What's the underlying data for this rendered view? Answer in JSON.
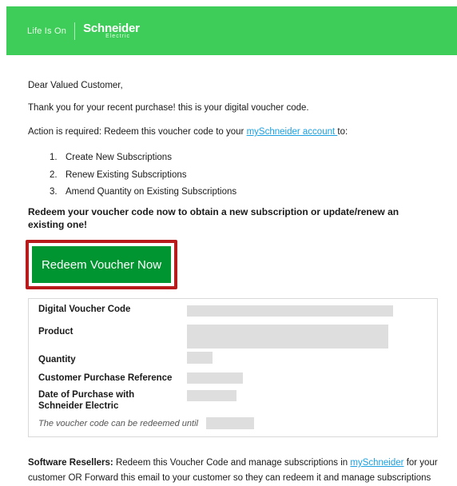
{
  "header": {
    "tagline": "Life Is On",
    "logo_main": "Schneider",
    "logo_sub": "Electric"
  },
  "greeting": "Dear Valued Customer,",
  "intro": "Thank you for your recent purchase! this is your digital voucher code.",
  "action": {
    "prefix": "Action is required: Redeem this voucher code to your ",
    "link": "mySchneider account ",
    "suffix": "to:"
  },
  "steps": [
    {
      "num": "1.",
      "text": "Create New Subscriptions"
    },
    {
      "num": "2.",
      "text": "Renew Existing Subscriptions"
    },
    {
      "num": "3.",
      "text": "Amend Quantity on Existing Subscriptions"
    }
  ],
  "bold_note": "Redeem your voucher code now to obtain a new subscription or update/renew an existing one!",
  "button_label": "Redeem Voucher Now",
  "details": {
    "voucher_code_label": "Digital Voucher Code",
    "product_label": "Product",
    "quantity_label": "Quantity",
    "purchase_ref_label": "Customer Purchase Reference",
    "purchase_date_label": "Date of Purchase with Schneider Electric",
    "redeem_until_note": "The voucher code can be redeemed until"
  },
  "footer": {
    "bold": "Software Resellers:",
    "text1": " Redeem this Voucher Code and manage subscriptions in ",
    "link": "mySchneider",
    "text2": " for your customer OR Forward this email to your customer so they can redeem it and manage subscriptions"
  },
  "colors": {
    "header_green": "#3dcd58",
    "button_green": "#009530",
    "highlight_red": "#b81b1b",
    "link_blue": "#1ba0e1"
  }
}
